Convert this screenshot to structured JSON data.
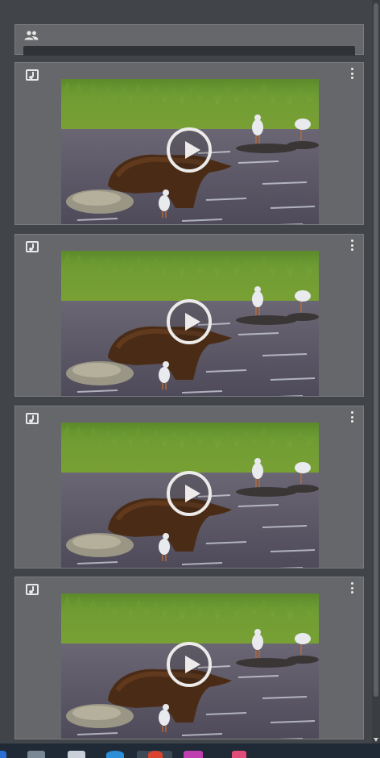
{
  "people_card": {
    "icon": "people-icon"
  },
  "media_items": [
    {
      "icon": "music-note-icon",
      "menu_icon": "more-vertical-icon",
      "thumbnail": "bear-in-river-with-gulls",
      "play_icon": "play-icon"
    },
    {
      "icon": "music-note-icon",
      "menu_icon": "more-vertical-icon",
      "thumbnail": "bear-in-river-with-gulls",
      "play_icon": "play-icon"
    },
    {
      "icon": "music-note-icon",
      "menu_icon": "more-vertical-icon",
      "thumbnail": "bear-in-river-with-gulls",
      "play_icon": "play-icon"
    },
    {
      "icon": "music-note-icon",
      "menu_icon": "more-vertical-icon",
      "thumbnail": "bear-in-river-with-gulls",
      "play_icon": "play-icon"
    }
  ],
  "taskbar": {
    "items": [
      "start-icon",
      "app-icon",
      "app-icon",
      "browser-icon",
      "app-icon",
      "app-icon",
      "app-icon"
    ]
  },
  "colors": {
    "background": "#3f4347",
    "card": "#66676a",
    "taskbar": "#1f2a36"
  }
}
